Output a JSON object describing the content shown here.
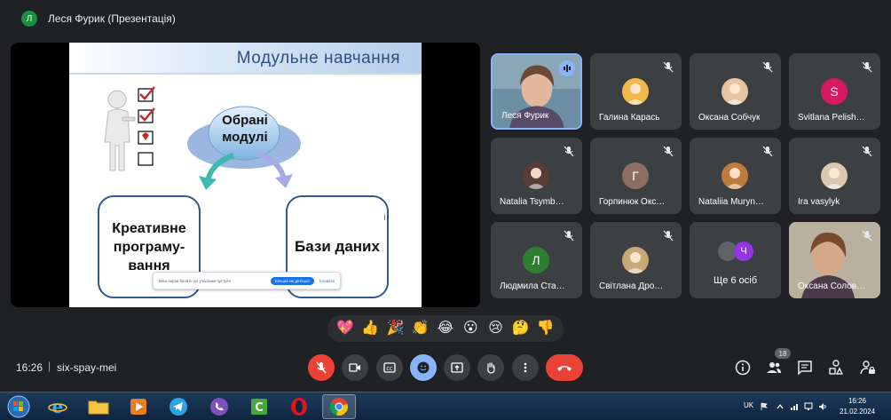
{
  "header": {
    "avatar_letter": "Л",
    "title": "Леся Фурик (Презентація)"
  },
  "slide": {
    "title": "Модульне навчання",
    "center_label": "Обрані модулі",
    "left_box": "Креативне програму-вання",
    "right_box": "Бази даних"
  },
  "share_banner": {
    "text": "Ваш екран бачать усі учасники зустрічі",
    "stop_label": "Більше не діліться",
    "hide_label": "Сховати"
  },
  "participants": [
    {
      "name": "Леся Фурик",
      "kind": "video",
      "active": true
    },
    {
      "name": "Галина Карась",
      "kind": "photo",
      "color": "#f2b84b"
    },
    {
      "name": "Оксана Собчук",
      "kind": "photo",
      "color": "#e8c4a0"
    },
    {
      "name": "Svitlana Pelish…",
      "kind": "letter",
      "letter": "S",
      "color": "#d81b60"
    },
    {
      "name": "Natalia Tsymb…",
      "kind": "photo",
      "color": "#5a3c36"
    },
    {
      "name": "Горпинюк Окс…",
      "kind": "letter",
      "letter": "Г",
      "color": "#8d6e63"
    },
    {
      "name": "Nataliia Muryn…",
      "kind": "photo",
      "color": "#c07a3a"
    },
    {
      "name": "Ira vasylyk",
      "kind": "photo",
      "color": "#d9c7b0"
    },
    {
      "name": "Людмила Ста…",
      "kind": "letter",
      "letter": "Л",
      "color": "#2e7d32"
    },
    {
      "name": "Світлана Дро…",
      "kind": "photo",
      "color": "#c9a978"
    },
    {
      "name": "Ще 6 осіб",
      "kind": "more",
      "letter": "Ч"
    },
    {
      "name": "Оксана Солов…",
      "kind": "video2"
    }
  ],
  "reactions": [
    "💖",
    "👍",
    "🎉",
    "👏",
    "😂",
    "😮",
    "😢",
    "🤔",
    "👎"
  ],
  "bottom": {
    "time": "16:26",
    "separator": "|",
    "meeting_code": "six-spay-mei",
    "people_count": "18"
  },
  "taskbar": {
    "lang": "UK",
    "time": "16:26",
    "date": "21.02.2024"
  },
  "colors": {
    "bg": "#202124",
    "tile": "#3c4043",
    "accent": "#8ab4f8",
    "danger": "#ea4335"
  }
}
